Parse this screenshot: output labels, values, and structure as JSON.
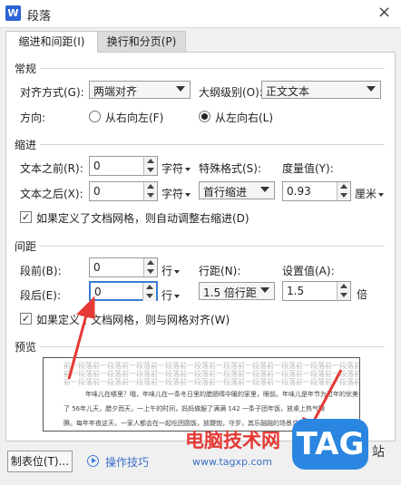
{
  "window": {
    "title": "段落",
    "app_logo": "W",
    "close": "×"
  },
  "tabs": [
    {
      "label": "缩进和间距(I)"
    },
    {
      "label": "换行和分页(P)"
    }
  ],
  "general": {
    "title": "常规",
    "align_label": "对齐方式(G):",
    "align_value": "两端对齐",
    "outline_label": "大纲级别(O):",
    "outline_value": "正文文本",
    "direction_label": "方向:",
    "rtl_label": "从右向左(F)",
    "ltr_label": "从左向右(L)"
  },
  "indent": {
    "title": "缩进",
    "before_label": "文本之前(R):",
    "before_value": "0",
    "before_unit": "字符",
    "after_label": "文本之后(X):",
    "after_value": "0",
    "after_unit": "字符",
    "special_label": "特殊格式(S):",
    "special_value": "首行缩进",
    "measure_label": "度量值(Y):",
    "measure_value": "0.93",
    "measure_unit": "厘米",
    "grid_check_label": "如果定义了文档网格，则自动调整右缩进(D)"
  },
  "spacing": {
    "title": "间距",
    "before_label": "段前(B):",
    "before_value": "0",
    "before_unit": "行",
    "after_label": "段后(E):",
    "after_value": "0",
    "after_unit": "行",
    "line_label": "行距(N):",
    "line_value": "1.5 倍行距",
    "set_label": "设置值(A):",
    "set_value": "1.5",
    "set_unit": "倍",
    "grid_check_label": "如果定义了文档网格，则与网格对齐(W)"
  },
  "preview": {
    "title": "预览",
    "ghost_line": "前一段落前一段落前一段落前一段落前一段落前一段落前一段落前一段落前一段落前一段落前一段落前一段落",
    "line1": "年味儿在哪里？哦，年味儿在一条冬日里的腊肠晴中暖的家里，眼前。年味儿是年节为过年的优美年货",
    "line2": "了 56年儿天，腊夕而天，一上午的时间，妈妈做服了满满 142 一条子团年饭，放桌上热气腾",
    "line3": "腾。每年年夜这天，一家人都会在一起吃团圆饭，放鞭炮，守岁，其乐融融的场景总在心中"
  },
  "footer": {
    "tabs_button": "制表位(T)...",
    "tips_button": "操作技巧"
  },
  "watermark": {
    "brand": "电脑技术网",
    "url": "www.tagxp.com",
    "logo": "TAG",
    "tail": "站"
  }
}
